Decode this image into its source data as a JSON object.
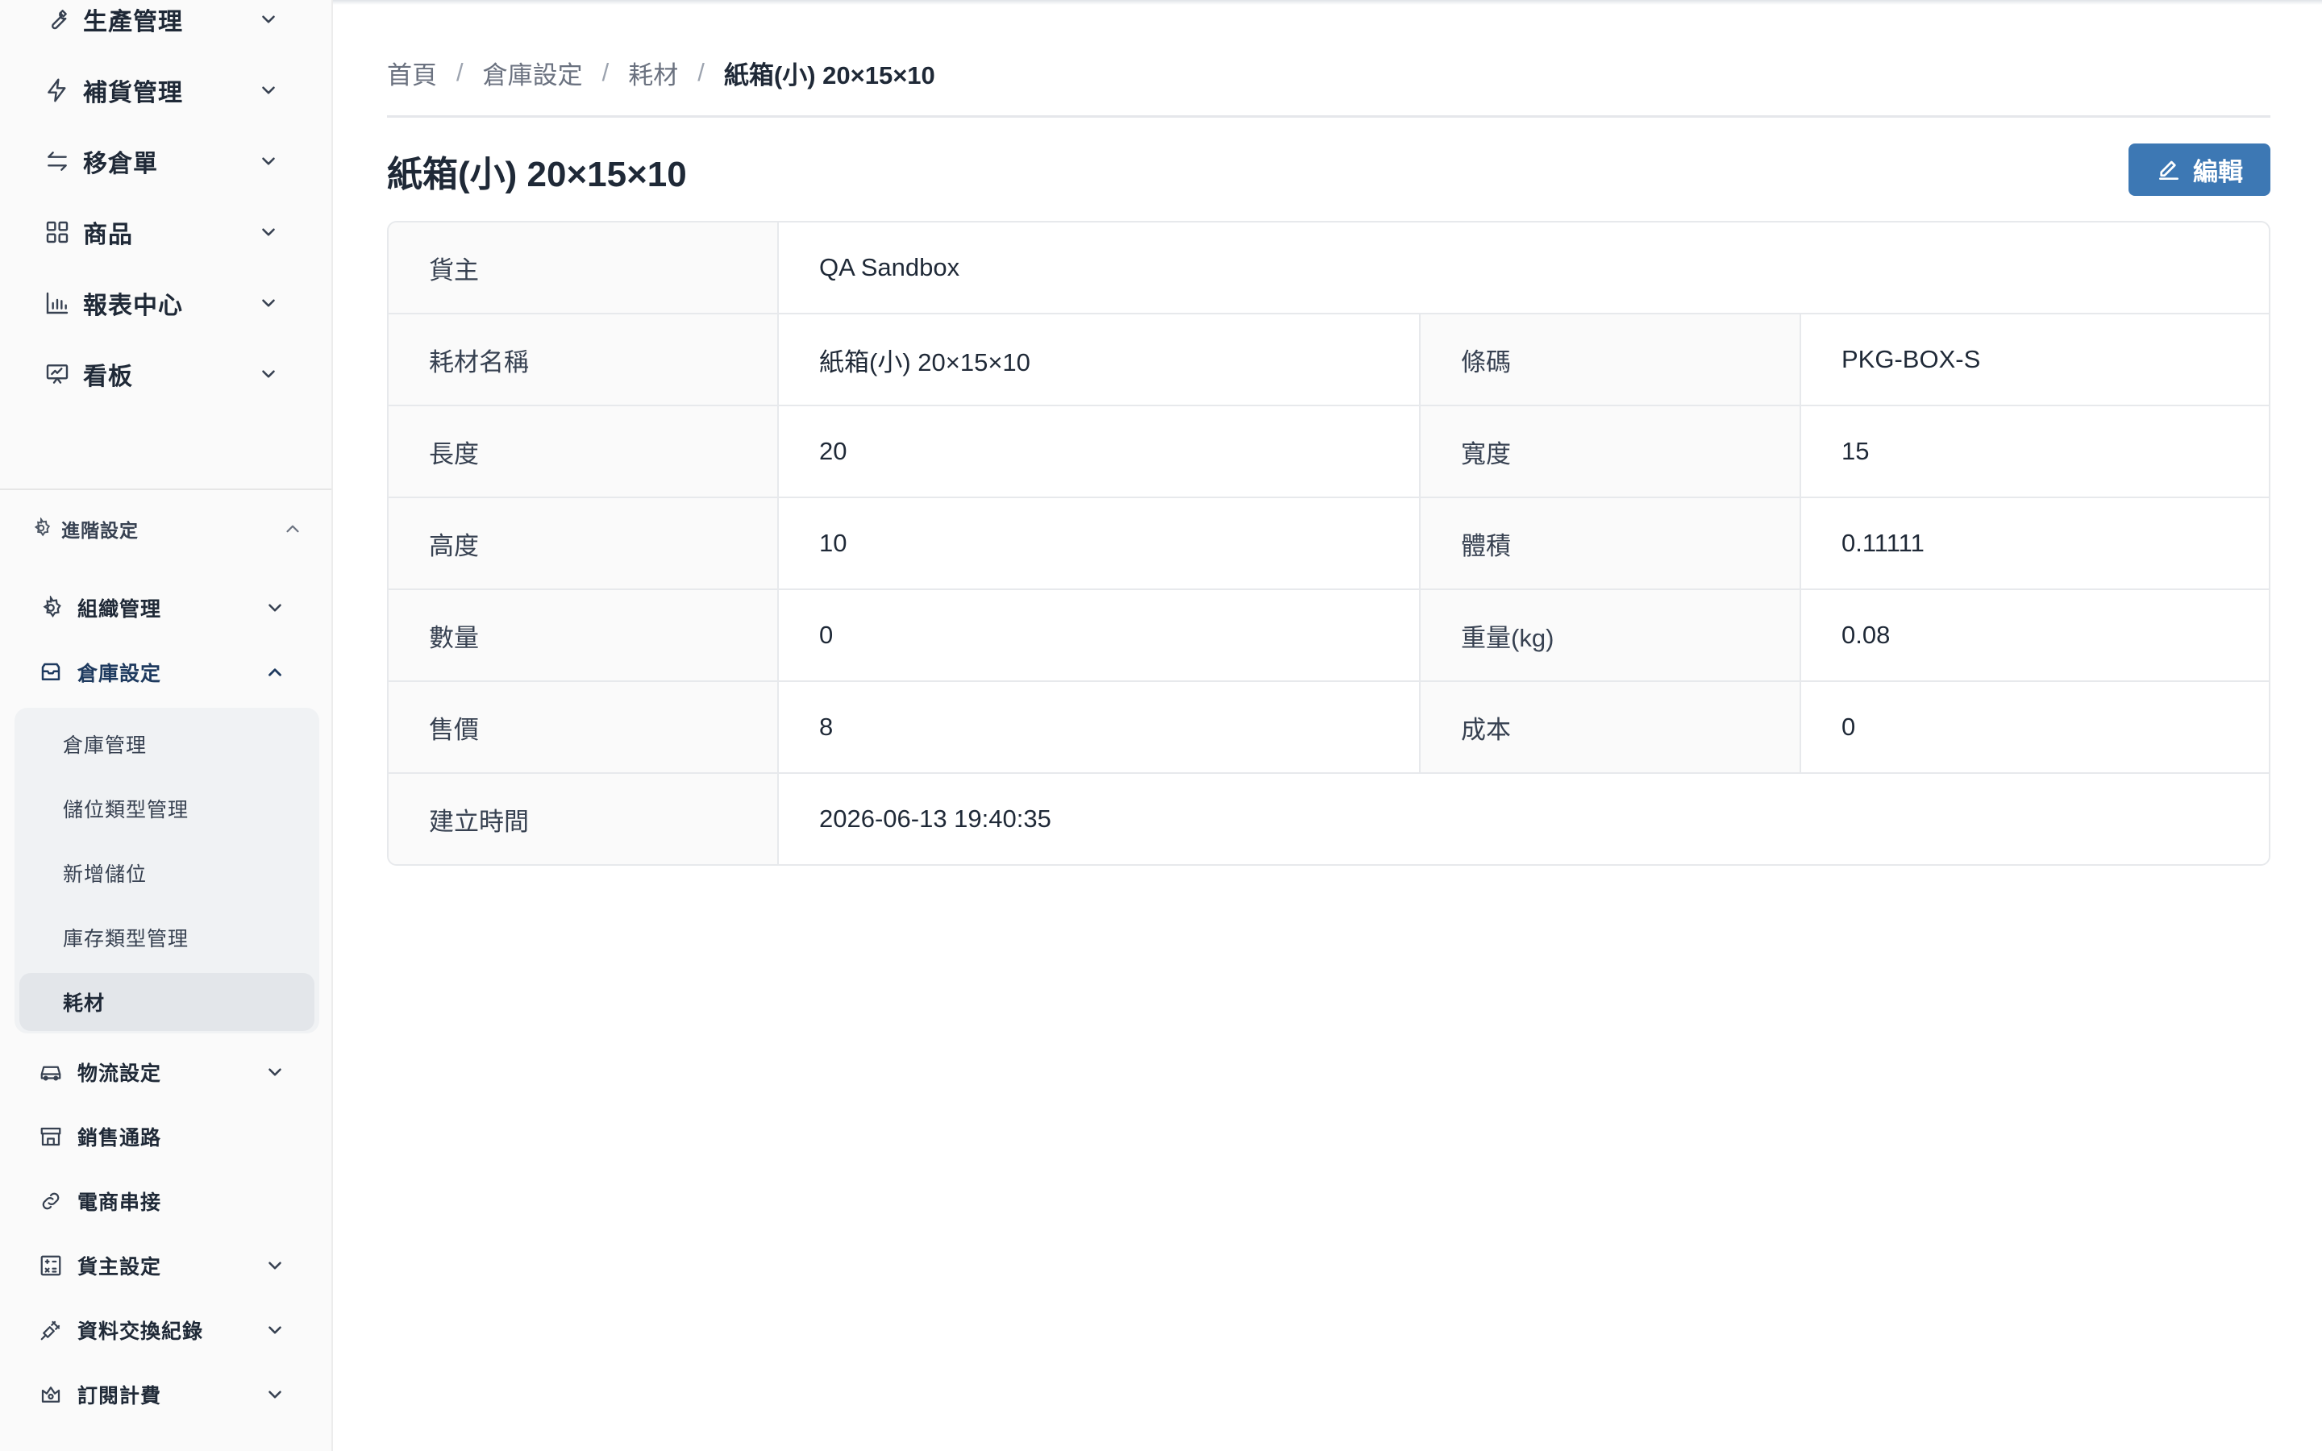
{
  "sidebar": {
    "top_items": [
      {
        "label": "生產管理",
        "icon": "wrench-icon"
      },
      {
        "label": "補貨管理",
        "icon": "lightning-icon"
      },
      {
        "label": "移倉單",
        "icon": "transfer-icon"
      },
      {
        "label": "商品",
        "icon": "grid-icon"
      },
      {
        "label": "報表中心",
        "icon": "bar-chart-icon"
      },
      {
        "label": "看板",
        "icon": "presentation-icon"
      }
    ],
    "section_label": "進階設定",
    "sub_items": [
      {
        "label": "組織管理",
        "icon": "gear-icon"
      },
      {
        "label": "倉庫設定",
        "icon": "inbox-icon"
      },
      {
        "label": "物流設定",
        "icon": "truck-icon"
      },
      {
        "label": "銷售通路",
        "icon": "store-icon"
      },
      {
        "label": "電商串接",
        "icon": "link-icon"
      },
      {
        "label": "貨主設定",
        "icon": "calculator-icon"
      },
      {
        "label": "資料交換紀錄",
        "icon": "plug-icon"
      },
      {
        "label": "訂閱計費",
        "icon": "subscription-icon"
      }
    ],
    "warehouse_children": [
      "倉庫管理",
      "儲位類型管理",
      "新增儲位",
      "庫存類型管理",
      "耗材"
    ]
  },
  "breadcrumb": {
    "home": "首頁",
    "level1": "倉庫設定",
    "level2": "耗材",
    "current": "紙箱(小) 20×15×10"
  },
  "page": {
    "title": "紙箱(小) 20×15×10",
    "edit_label": "編輯",
    "accent_color": "#3d78b4"
  },
  "details": {
    "owner_label": "貨主",
    "owner_value": "QA Sandbox",
    "name_label": "耗材名稱",
    "name_value": "紙箱(小) 20×15×10",
    "barcode_label": "條碼",
    "barcode_value": "PKG-BOX-S",
    "length_label": "長度",
    "length_value": "20",
    "width_label": "寬度",
    "width_value": "15",
    "height_label": "高度",
    "height_value": "10",
    "volume_label": "體積",
    "volume_value": "0.11111",
    "qty_label": "數量",
    "qty_value": "0",
    "weight_label": "重量(kg)",
    "weight_value": "0.08",
    "price_label": "售價",
    "price_value": "8",
    "cost_label": "成本",
    "cost_value": "0",
    "created_label": "建立時間",
    "created_value": "2026-06-13 19:40:35"
  }
}
